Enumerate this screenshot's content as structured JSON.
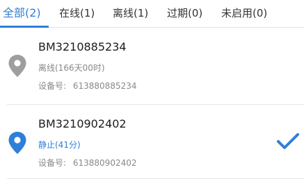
{
  "tabs": [
    {
      "label": "全部(2)",
      "active": true
    },
    {
      "label": "在线(1)",
      "active": false
    },
    {
      "label": "离线(1)",
      "active": false
    },
    {
      "label": "过期(0)",
      "active": false
    },
    {
      "label": "未启用(0)",
      "active": false
    }
  ],
  "devices": [
    {
      "name": "BM3210885234",
      "status": "离线(166天00时)",
      "device_label": "设备号:",
      "device_no": "613880885234",
      "icon": "location-pin-icon",
      "icon_color": "#9e9e9e",
      "selected": false
    },
    {
      "name": "BM3210902402",
      "status": "静止(41分)",
      "device_label": "设备号:",
      "device_no": "613880902402",
      "icon": "location-pin-icon",
      "icon_color": "#2f7fd8",
      "selected": true
    }
  ],
  "colors": {
    "accent": "#2f7fd8",
    "offline": "#9e9e9e",
    "muted_text": "#888888"
  }
}
